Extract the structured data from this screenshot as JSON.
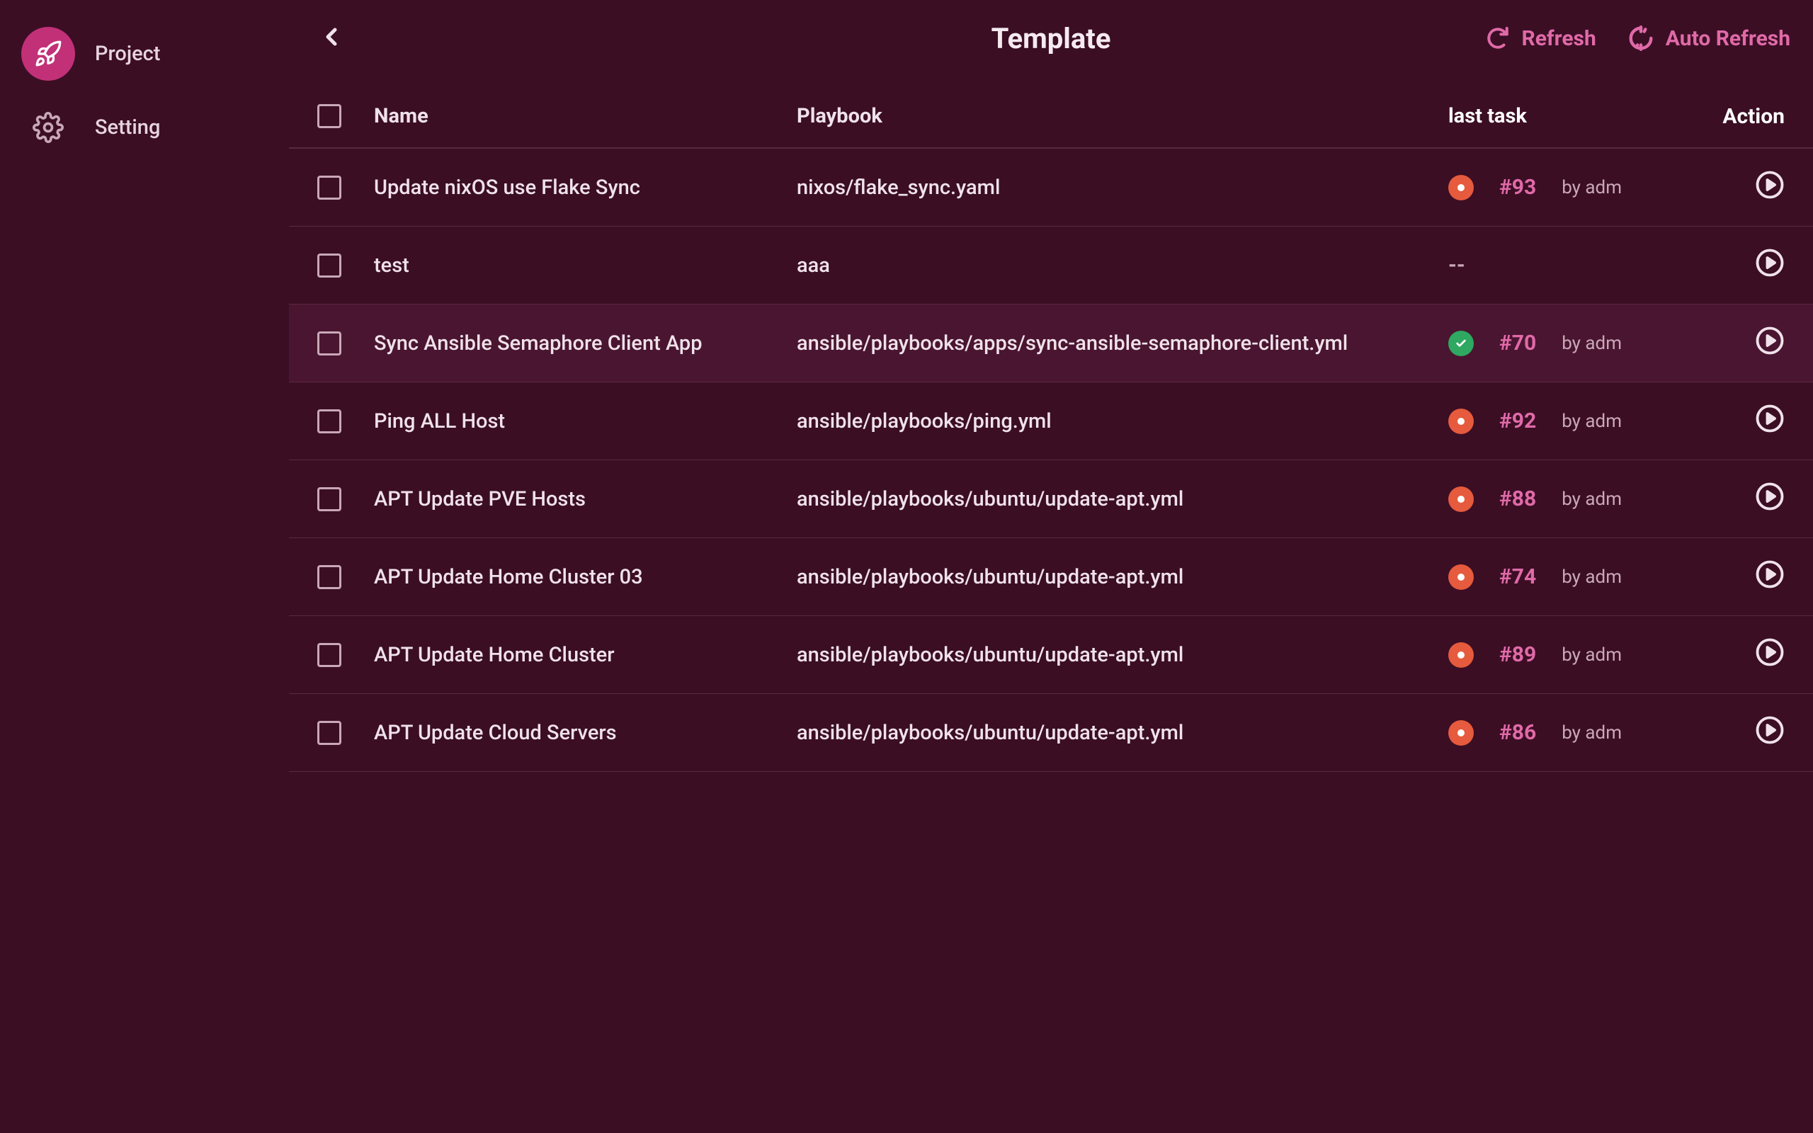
{
  "sidebar": {
    "items": [
      {
        "label": "Project"
      },
      {
        "label": "Setting"
      }
    ]
  },
  "header": {
    "title": "Template",
    "refresh": "Refresh",
    "auto_refresh": "Auto Refresh"
  },
  "table": {
    "columns": {
      "name": "Name",
      "playbook": "Playbook",
      "last_task": "last task",
      "action": "Action"
    },
    "rows": [
      {
        "name": "Update nixOS use Flake Sync",
        "playbook": "nixos/flake_sync.yaml",
        "status": "running",
        "task_id": "#93",
        "by": "by adm"
      },
      {
        "name": "test",
        "playbook": "aaa",
        "status": "none",
        "task_id": "--",
        "by": ""
      },
      {
        "name": "Sync Ansible Semaphore Client App",
        "playbook": "ansible/playbooks/apps/sync-ansible-semaphore-client.yml",
        "status": "success",
        "task_id": "#70",
        "by": "by adm"
      },
      {
        "name": "Ping ALL Host",
        "playbook": "ansible/playbooks/ping.yml",
        "status": "running",
        "task_id": "#92",
        "by": "by adm"
      },
      {
        "name": "APT Update PVE Hosts",
        "playbook": "ansible/playbooks/ubuntu/update-apt.yml",
        "status": "running",
        "task_id": "#88",
        "by": "by adm"
      },
      {
        "name": "APT Update Home Cluster 03",
        "playbook": "ansible/playbooks/ubuntu/update-apt.yml",
        "status": "running",
        "task_id": "#74",
        "by": "by adm"
      },
      {
        "name": "APT Update Home Cluster",
        "playbook": "ansible/playbooks/ubuntu/update-apt.yml",
        "status": "running",
        "task_id": "#89",
        "by": "by adm"
      },
      {
        "name": "APT Update Cloud Servers",
        "playbook": "ansible/playbooks/ubuntu/update-apt.yml",
        "status": "running",
        "task_id": "#86",
        "by": "by adm"
      }
    ]
  }
}
